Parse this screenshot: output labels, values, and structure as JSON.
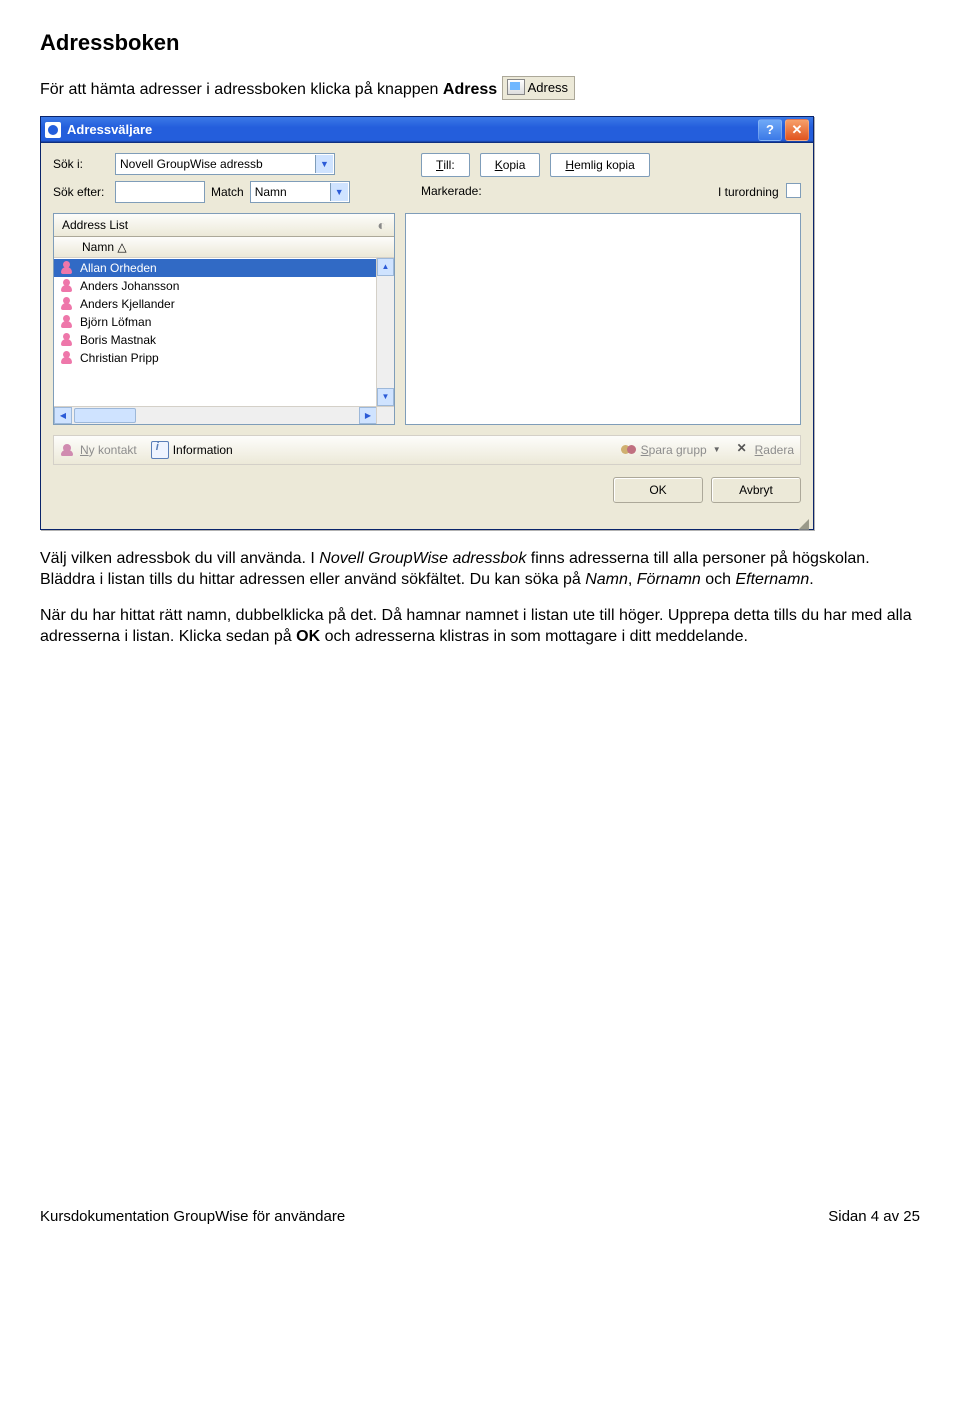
{
  "doc": {
    "heading": "Adressboken",
    "intro_pre": "För att hämta adresser i adressboken klicka på knappen ",
    "intro_bold": "Adress",
    "adress_btn_label": "Adress",
    "para2_a": "Välj vilken adressbok du vill använda. I ",
    "para2_i": "Novell GroupWise adressbok",
    "para2_b": " finns adresserna till alla personer på högskolan. Bläddra i listan tills du hittar adressen eller använd sökfältet. Du kan söka på ",
    "para2_c_list": "Namn",
    "para2_d": ", ",
    "para2_e_list": "Förnamn",
    "para2_f": " och ",
    "para2_g_list": "Efternamn",
    "para2_h": ".",
    "para3_a": "När du har hittat rätt namn, dubbelklicka på det. Då hamnar namnet i listan ute till höger. Upprepa detta tills du har med alla adresserna i listan. Klicka sedan på ",
    "para3_b_bold": "OK",
    "para3_c": " och adresserna klistras in som mottagare i ditt meddelande."
  },
  "dialog": {
    "title": "Adressväljare",
    "help": "?",
    "close": "✕",
    "sok_i_label": "Sök i:",
    "sok_i_value": "Novell GroupWise adressb",
    "sok_efter_label": "Sök efter:",
    "match_label": "Match",
    "match_value": "Namn",
    "till_btn": "Till:",
    "kopia_btn": "Kopia",
    "hemlig_btn": "Hemlig kopia",
    "markerade_label": "Markerade:",
    "turordning_label": "I turordning",
    "list_header_tab": "Address List",
    "col_name": "Namn △",
    "names": [
      "Allan Orheden",
      "Anders Johansson",
      "Anders Kjellander",
      "Björn Löfman",
      "Boris Mastnak",
      "Christian Pripp"
    ],
    "tool_nykontakt": "Ny kontakt",
    "tool_information": "Information",
    "tool_sparagrupp": "Spara grupp",
    "tool_radera": "Radera",
    "ok_btn": "OK",
    "avbryt_btn": "Avbryt"
  },
  "footer": {
    "left": "Kursdokumentation GroupWise för användare",
    "right": "Sidan 4 av 25"
  }
}
